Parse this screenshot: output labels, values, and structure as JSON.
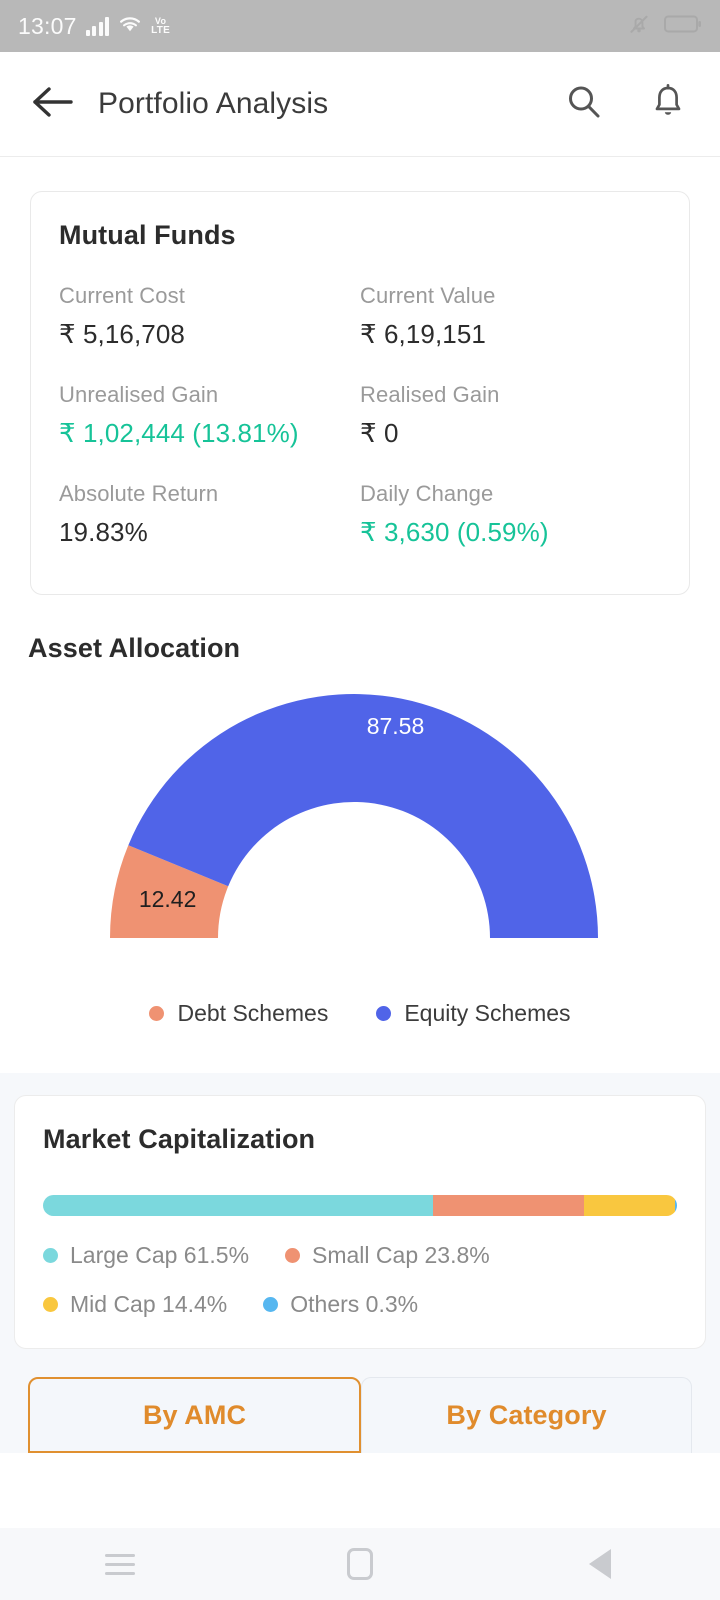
{
  "status_bar": {
    "time": "13:07",
    "network_label_top": "Vo",
    "network_label_bottom": "LTE",
    "icons": [
      "signal-bars-icon",
      "wifi-icon",
      "volte-icon",
      "mute-icon",
      "battery-icon"
    ]
  },
  "app_bar": {
    "title": "Portfolio Analysis",
    "back_icon": "back-arrow-icon",
    "search_icon": "search-icon",
    "notification_icon": "bell-icon"
  },
  "summary_card": {
    "title": "Mutual Funds",
    "stats": [
      {
        "label": "Current Cost",
        "value": "₹ 5,16,708",
        "positive": false
      },
      {
        "label": "Current Value",
        "value": "₹ 6,19,151",
        "positive": false
      },
      {
        "label": "Unrealised Gain",
        "value": "₹ 1,02,444 (13.81%)",
        "positive": true
      },
      {
        "label": "Realised Gain",
        "value": "₹ 0",
        "positive": false
      },
      {
        "label": "Absolute Return",
        "value": "19.83%",
        "positive": false
      },
      {
        "label": "Daily Change",
        "value": "₹ 3,630 (0.59%)",
        "positive": true
      }
    ]
  },
  "asset_allocation": {
    "title": "Asset Allocation",
    "legend": [
      {
        "label": "Debt Schemes",
        "color": "#ef9272"
      },
      {
        "label": "Equity Schemes",
        "color": "#5064e8"
      }
    ]
  },
  "market_capitalization": {
    "title": "Market Capitalization",
    "legend": [
      {
        "label": "Large Cap 61.5%",
        "color": "#7bd8dd"
      },
      {
        "label": "Small Cap 23.8%",
        "color": "#ef9272"
      },
      {
        "label": "Mid Cap 14.4%",
        "color": "#f9c73f"
      },
      {
        "label": "Others 0.3%",
        "color": "#57b7f0"
      }
    ]
  },
  "tabs": [
    {
      "label": "By AMC",
      "active": true
    },
    {
      "label": "By Category",
      "active": false
    }
  ],
  "nav_bar": {
    "recents_icon": "recents-icon",
    "home_icon": "home-icon",
    "back_icon": "back-triangle-icon"
  },
  "colors": {
    "positive": "#16c398",
    "equity": "#5064e8",
    "debt": "#ef9272",
    "large_cap": "#7bd8dd",
    "small_cap": "#ef9272",
    "mid_cap": "#f9c73f",
    "others": "#57b7f0",
    "tab_accent": "#e09030"
  },
  "chart_data": [
    {
      "type": "pie",
      "title": "Asset Allocation",
      "subtype": "semicircle-donut-gauge",
      "categories": [
        "Debt Schemes",
        "Equity Schemes"
      ],
      "values": [
        12.42,
        87.58
      ],
      "labels": [
        "12.42",
        "87.58"
      ],
      "colors": [
        "#ef9272",
        "#5064e8"
      ],
      "legend_position": "bottom",
      "start_angle_deg": 180,
      "end_angle_deg": 360,
      "grid": false
    },
    {
      "type": "bar",
      "subtype": "stacked-horizontal-100pct",
      "title": "Market Capitalization",
      "categories": [
        "Large Cap",
        "Small Cap",
        "Mid Cap",
        "Others"
      ],
      "values": [
        61.5,
        23.8,
        14.4,
        0.3
      ],
      "labels": [
        "Large Cap 61.5%",
        "Small Cap 23.8%",
        "Mid Cap 14.4%",
        "Others 0.3%"
      ],
      "colors": [
        "#7bd8dd",
        "#ef9272",
        "#f9c73f",
        "#57b7f0"
      ],
      "xlabel": "",
      "ylabel": "",
      "xlim": [
        0,
        100
      ],
      "legend_position": "bottom",
      "grid": false
    }
  ]
}
